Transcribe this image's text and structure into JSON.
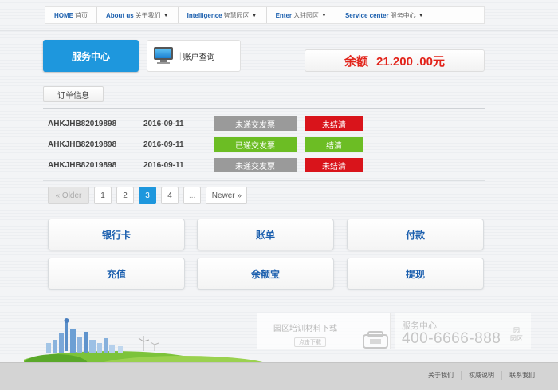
{
  "nav": {
    "items": [
      {
        "en": "HOME",
        "cn": "首页",
        "caret": ""
      },
      {
        "en": "About us",
        "cn": "关于我们",
        "caret": "▼"
      },
      {
        "en": "Intelligence",
        "cn": "智慧园区",
        "caret": "▼"
      },
      {
        "en": "Enter",
        "cn": "入驻园区",
        "caret": "▼"
      },
      {
        "en": "Service center",
        "cn": "服务中心",
        "caret": "▼"
      }
    ]
  },
  "tabs": {
    "service": "服务中心",
    "account_bar": "|",
    "account": "账户查询"
  },
  "balance": {
    "label": "余额",
    "value": "21.200 .00元"
  },
  "orders": {
    "button": "订单信息",
    "rows": [
      {
        "id": "AHKJHB82019898",
        "date": "2016-09-11",
        "invoice": "未递交发票",
        "invoice_color": "#9a9a9a",
        "settle": "未结清",
        "settle_color": "#d9141b"
      },
      {
        "id": "AHKJHB82019898",
        "date": "2016-09-11",
        "invoice": "已递交发票",
        "invoice_color": "#6cbd24",
        "settle": "结清",
        "settle_color": "#6cbd24"
      },
      {
        "id": "AHKJHB82019898",
        "date": "2016-09-11",
        "invoice": "未递交发票",
        "invoice_color": "#9a9a9a",
        "settle": "未结清",
        "settle_color": "#d9141b"
      }
    ]
  },
  "pagination": {
    "older": "« Older",
    "pages": [
      "1",
      "2",
      "3",
      "4"
    ],
    "active_page": "3",
    "ellipsis": "...",
    "newer": "Newer »"
  },
  "actions": {
    "bank_card": "银行卡",
    "bill": "账单",
    "payment": "付款",
    "recharge": "充值",
    "yuebao": "余额宝",
    "withdraw": "提现"
  },
  "promo": {
    "title": "园区培训材料下载",
    "download": "点击下载"
  },
  "service_box": {
    "title": "服务中心",
    "phone": "400-6666-888",
    "chip_top": "园",
    "chip_bottom": "园区"
  },
  "footer": {
    "links": [
      "关于我们",
      "权威说明",
      "联系我们"
    ]
  },
  "colors": {
    "accent_blue": "#1e97dd",
    "link_blue": "#1b5fae",
    "balance_red": "#e2231a",
    "status_green": "#6cbd24",
    "status_red": "#d9141b",
    "status_gray": "#9a9a9a"
  },
  "icons": {
    "account_tab": "monitor-icon",
    "promo": "phone-icon",
    "decoration": "city-skyline-icon"
  }
}
